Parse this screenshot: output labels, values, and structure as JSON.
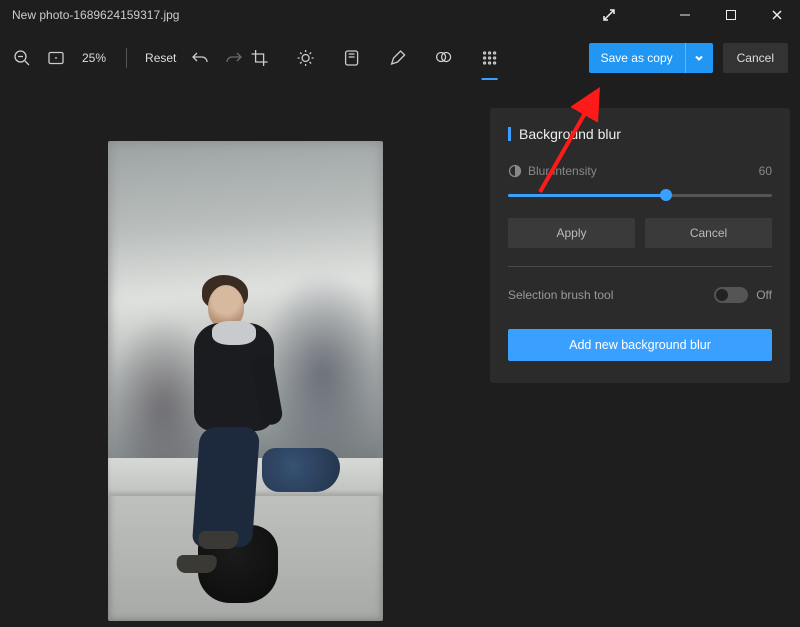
{
  "titlebar": {
    "title": "New photo-1689624159317.jpg"
  },
  "toolbar": {
    "zoom_pct": "25%",
    "reset_label": "Reset",
    "save_label": "Save as copy",
    "cancel_label": "Cancel"
  },
  "panel": {
    "title": "Background blur",
    "slider": {
      "label": "Blur intensity",
      "value": 60,
      "value_text": "60",
      "min": 0,
      "max": 100
    },
    "apply_label": "Apply",
    "cancel_label": "Cancel",
    "brush": {
      "label": "Selection brush tool",
      "state_text": "Off",
      "on": false
    },
    "add_label": "Add new background blur"
  },
  "colors": {
    "accent": "#3aa0ff",
    "save_blue": "#2196f3"
  }
}
